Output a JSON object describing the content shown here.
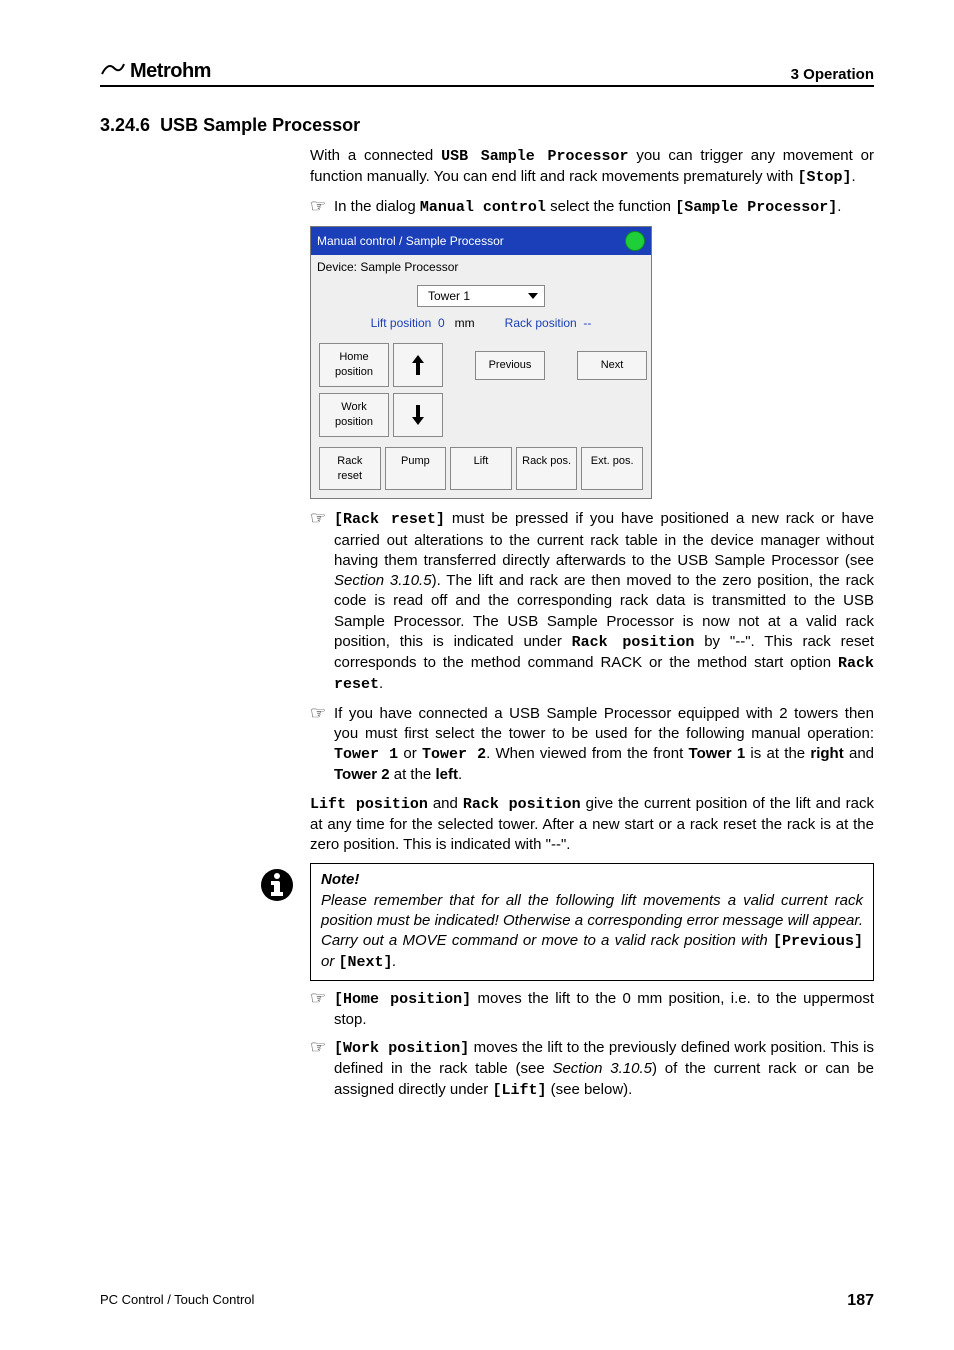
{
  "header": {
    "logo_text": "Metrohm",
    "right": "3 Operation"
  },
  "section": {
    "number": "3.24.6",
    "title": "USB Sample Processor"
  },
  "intro": {
    "t1": "With a connected ",
    "usb": "USB Sample Processor",
    "t2": " you can trigger any movement or function manually. You can end lift and rack movements prematurely with ",
    "stop": "[Stop]",
    "t3": "."
  },
  "p1": {
    "t1": "In the dialog ",
    "mc": "Manual control",
    "t2": " select the function ",
    "sp": "[Sample Processor]",
    "t3": "."
  },
  "ui": {
    "title": "Manual control / Sample Processor",
    "device": "Device: Sample Processor",
    "tower": "Tower 1",
    "lift_label": "Lift position",
    "lift_val": "0",
    "lift_unit": "mm",
    "rack_label": "Rack position",
    "rack_val": "--",
    "home": "Home position",
    "work": "Work position",
    "previous": "Previous",
    "next": "Next",
    "rack_reset": "Rack reset",
    "pump": "Pump",
    "lift_btn": "Lift",
    "rack_pos": "Rack pos.",
    "ext_pos": "Ext. pos."
  },
  "p2": {
    "rr": "[Rack reset]",
    "t1": " must be pressed if you have positioned a new rack or have carried out alterations to the current rack table in the device manager without having them transferred directly afterwards to the USB Sample Processor (see ",
    "sec": "Section 3.10.5",
    "t2": "). The lift and rack are then moved to the zero position, the rack code is read off and the corresponding rack data is transmitted to the USB Sample Processor. The USB Sample Processor is now not at a valid rack position, this is indicated under ",
    "rp": "Rack position",
    "t3": " by \"--\". This rack reset corresponds to the method command RACK or the method start option ",
    "rr2": "Rack reset",
    "t4": "."
  },
  "p3": {
    "t1": "If you have connected a USB Sample Processor equipped with 2 towers then you must first select the tower to be used for the following manual operation: ",
    "tw1": "Tower 1",
    "or": " or ",
    "tw2": "Tower 2",
    "t2": ". When viewed from the front ",
    "tw1b": "Tower 1",
    "t3": " is at the ",
    "right": "right",
    "t4": " and ",
    "tw2b": "Tower 2",
    "t5": " at the ",
    "left": "left",
    "t6": "."
  },
  "p4": {
    "lp": "Lift position",
    "t1": " and ",
    "rp": "Rack position",
    "t2": " give the current position of the lift and rack at any time for the selected tower. After a new start or a rack reset the rack is at the zero position. This is indicated with \"--\"."
  },
  "note": {
    "title": "Note!",
    "t1": "Please remember that for all the following lift movements a valid current rack position must be indicated! Otherwise a corresponding error message will appear. Carry out a MOVE command or move to a valid rack position with ",
    "prev": "[Previous]",
    "or": " or ",
    "next": "[Next]",
    "t2": "."
  },
  "p5": {
    "hp": "[Home position]",
    "t1": " moves the lift to the 0 mm position, i.e. to the uppermost stop."
  },
  "p6": {
    "wp": "[Work position]",
    "t1": " moves the lift to the previously defined work position. This is defined in the rack table (see ",
    "sec": "Section 3.10.5",
    "t2": ") of the current rack or can be assigned directly under ",
    "lift": "[Lift]",
    "t3": " (see below)."
  },
  "footer": {
    "left": "PC Control / Touch Control",
    "right": "187"
  }
}
